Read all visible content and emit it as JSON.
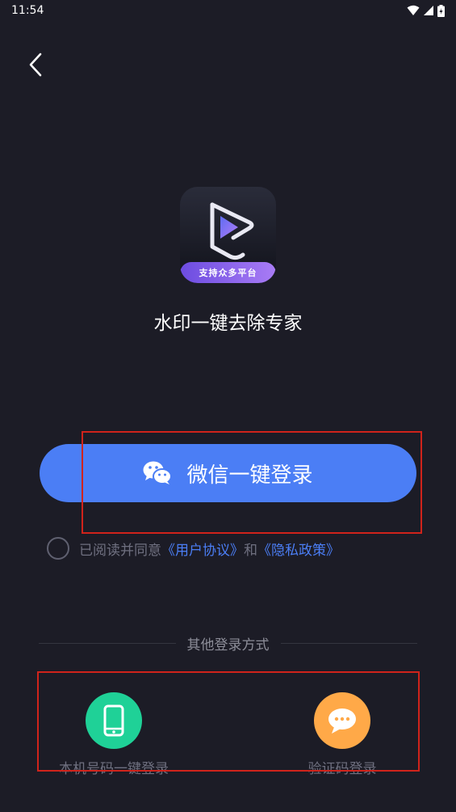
{
  "status_bar": {
    "time": "11:54"
  },
  "app": {
    "name": "水印一键去除专家",
    "logo_band_text": "支持众多平台"
  },
  "wechat_login": {
    "label": "微信一键登录",
    "color": "#4b7ef5"
  },
  "agreement": {
    "prefix": "已阅读并同意",
    "user_agreement": "《用户协议》",
    "joiner": "和",
    "privacy_policy": "《隐私政策》"
  },
  "other_login": {
    "title": "其他登录方式",
    "phone": {
      "label": "本机号码一键登录",
      "icon": "phone-icon",
      "color": "#1fd197"
    },
    "sms": {
      "label": "验证码登录",
      "icon": "chat-bubble-icon",
      "color": "#ffa948"
    }
  },
  "highlight_color": "#d0231b"
}
